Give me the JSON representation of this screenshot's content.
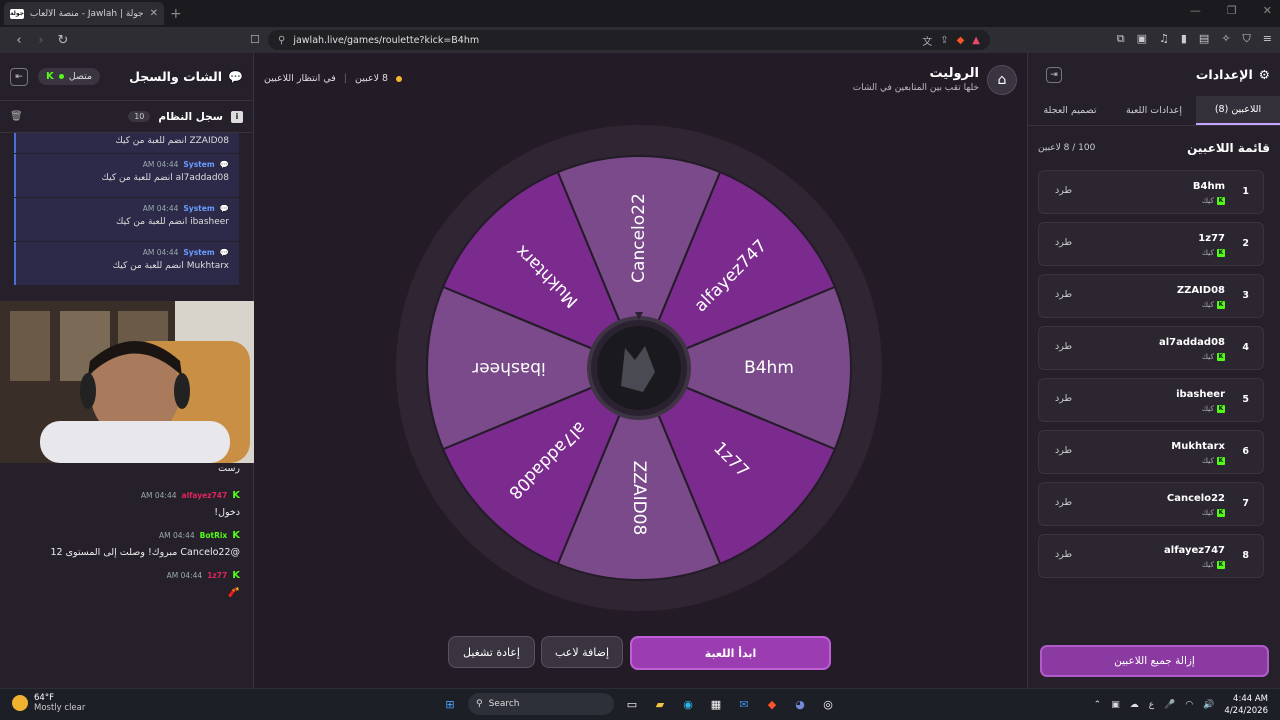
{
  "browser": {
    "tab_title": "جولة | Jawlah - منصة الألعاب التفا",
    "tab_favicon": "جولة",
    "url": "jawlah.live/games/roulette?kick=B4hm"
  },
  "chat": {
    "title": "الشات والسجل",
    "connected_label": "متصل",
    "syslog_title": "سجل النظام",
    "syslog_count": "10",
    "system_messages": [
      {
        "author": "",
        "time": "",
        "text": "ZZAID08 انضم للعبة من كيك"
      },
      {
        "author": "System",
        "time": "04:44 AM",
        "text": "al7addad08 انضم للعبة من كيك"
      },
      {
        "author": "System",
        "time": "04:44 AM",
        "text": "ibasheer انضم للعبة من كيك"
      },
      {
        "author": "System",
        "time": "04:44 AM",
        "text": "Mukhtarx انضم للعبة من كيك"
      }
    ],
    "messages": [
      {
        "author": "",
        "time": "",
        "text": "رست",
        "color": "#e8e4ec"
      },
      {
        "author": "alfayez747",
        "time": "04:44 AM",
        "text": "دخول!",
        "color": "#e0245e"
      },
      {
        "author": "BotRix",
        "time": "04:44 AM",
        "text": "@Cancelo22 مبروك! وصلت إلى المستوى 12",
        "color": "#53fc18"
      },
      {
        "author": "1z77",
        "time": "04:44 AM",
        "text": "🧨",
        "color": "#e0245e"
      }
    ]
  },
  "game": {
    "title": "الروليت",
    "subtitle": "خلها تقب بين المتابعين في الشات",
    "player_count_label": "8 لاعبين",
    "status_label": "في انتظار اللاعبين",
    "start_button": "ابدأ اللعبة",
    "add_player_button": "إضافة لاعب",
    "restart_button": "إعادة تشغيل",
    "wheel_segments": [
      "B4hm",
      "1z77",
      "ZZAID08",
      "al7addad08",
      "ibasheer",
      "Mukhtarx",
      "Cancelo22",
      "alfayez747"
    ],
    "colors": {
      "light": "#7a4a8a",
      "dark": "#7b2b8e",
      "accent": "#9b3db0"
    }
  },
  "settings": {
    "title": "الإعدادات",
    "tabs": [
      "اللاعبين (8)",
      "إعدادات اللعبة",
      "تصميم العجلة"
    ],
    "player_list_title": "قائمة اللاعبين",
    "player_count": "100 / 8 لاعبين",
    "platform_label": "كيك",
    "kick_label": "طرد",
    "players": [
      {
        "num": "1",
        "name": "B4hm"
      },
      {
        "num": "2",
        "name": "1z77"
      },
      {
        "num": "3",
        "name": "ZZAID08"
      },
      {
        "num": "4",
        "name": "al7addad08"
      },
      {
        "num": "5",
        "name": "ibasheer"
      },
      {
        "num": "6",
        "name": "Mukhtarx"
      },
      {
        "num": "7",
        "name": "Cancelo22"
      },
      {
        "num": "8",
        "name": "alfayez747"
      }
    ],
    "remove_all_button": "إزالة جميع اللاعبين"
  },
  "taskbar": {
    "temperature": "64°F",
    "weather": "Mostly clear",
    "search_placeholder": "Search",
    "time": "4:44 AM",
    "date": "4/24/2026",
    "language": "ع"
  }
}
